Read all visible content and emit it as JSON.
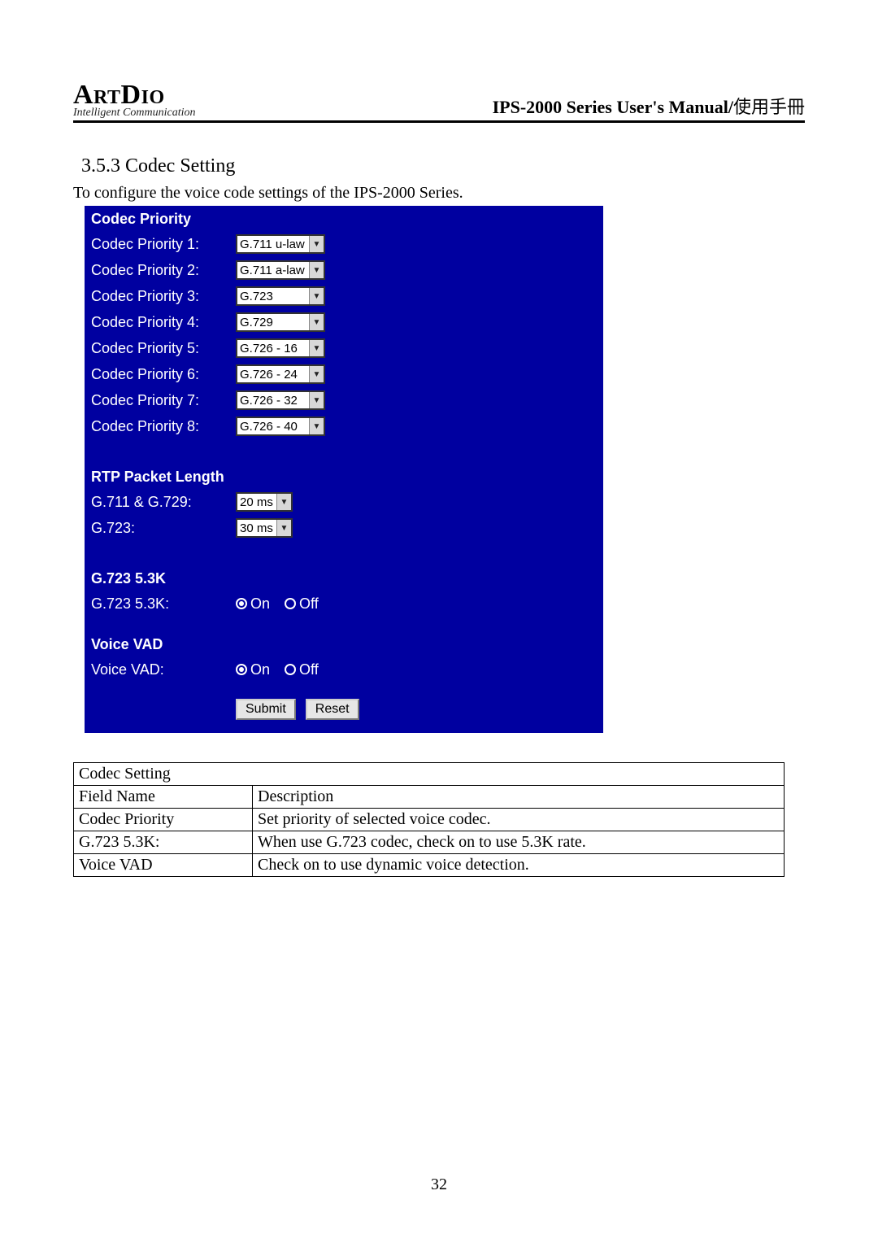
{
  "header": {
    "logo_line1": "ArtDio",
    "logo_line2": "Intelligent Communication",
    "title_bold": "IPS-2000 Series User's Manual/",
    "title_rest": "使用手冊"
  },
  "section": {
    "heading": "3.5.3 Codec Setting",
    "intro": "To configure the voice code settings of the IPS-2000 Series."
  },
  "panel": {
    "codec_priority_heading": "Codec Priority",
    "codec_rows": [
      {
        "label": "Codec Priority 1:",
        "value": "G.711 u-law"
      },
      {
        "label": "Codec Priority 2:",
        "value": "G.711 a-law"
      },
      {
        "label": "Codec Priority 3:",
        "value": "G.723"
      },
      {
        "label": "Codec Priority 4:",
        "value": "G.729"
      },
      {
        "label": "Codec Priority 5:",
        "value": "G.726 - 16"
      },
      {
        "label": "Codec Priority 6:",
        "value": "G.726 - 24"
      },
      {
        "label": "Codec Priority 7:",
        "value": "G.726 - 32"
      },
      {
        "label": "Codec Priority 8:",
        "value": "G.726 - 40"
      }
    ],
    "rtp_heading": "RTP Packet Length",
    "rtp_rows": [
      {
        "label": "G.711 & G.729:",
        "value": "20 ms"
      },
      {
        "label": "G.723:",
        "value": "30 ms"
      }
    ],
    "g723_heading": "G.723 5.3K",
    "g723_label": "G.723 5.3K:",
    "vad_heading": "Voice VAD",
    "vad_label": "Voice VAD:",
    "radio_on": "On",
    "radio_off": "Off",
    "submit": "Submit",
    "reset": "Reset"
  },
  "table": {
    "title": "Codec Setting",
    "col_field": "Field Name",
    "col_desc": "Description",
    "rows": [
      {
        "field": "Codec Priority",
        "desc": "Set priority of selected voice codec."
      },
      {
        "field": "G.723 5.3K:",
        "desc": "When use G.723 codec, check on to use 5.3K rate."
      },
      {
        "field": "Voice VAD",
        "desc": "Check on to use dynamic voice detection."
      }
    ]
  },
  "page_number": "32"
}
